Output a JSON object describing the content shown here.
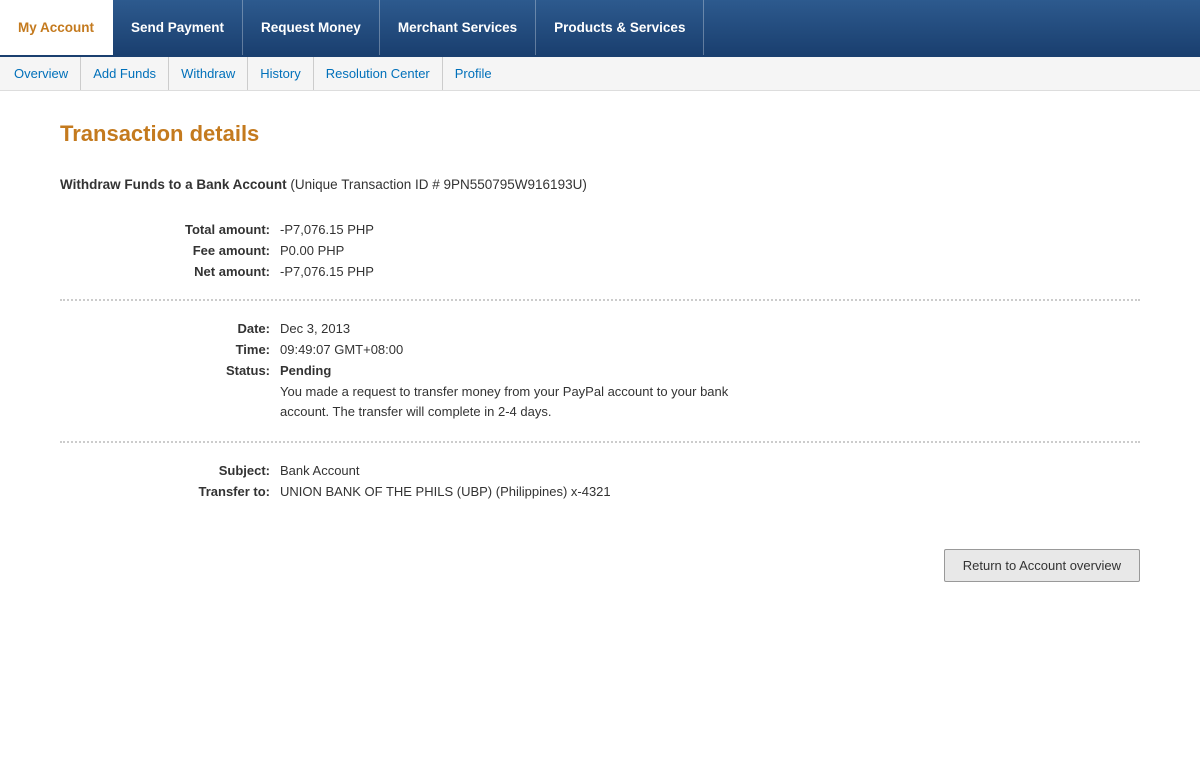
{
  "top_nav": {
    "items": [
      {
        "id": "my-account",
        "label": "My Account",
        "active": true
      },
      {
        "id": "send-payment",
        "label": "Send Payment",
        "active": false
      },
      {
        "id": "request-money",
        "label": "Request Money",
        "active": false
      },
      {
        "id": "merchant-services",
        "label": "Merchant Services",
        "active": false
      },
      {
        "id": "products-services",
        "label": "Products & Services",
        "active": false
      }
    ]
  },
  "sub_nav": {
    "items": [
      {
        "id": "overview",
        "label": "Overview"
      },
      {
        "id": "add-funds",
        "label": "Add Funds"
      },
      {
        "id": "withdraw",
        "label": "Withdraw"
      },
      {
        "id": "history",
        "label": "History"
      },
      {
        "id": "resolution-center",
        "label": "Resolution Center"
      },
      {
        "id": "profile",
        "label": "Profile"
      }
    ]
  },
  "page": {
    "title": "Transaction details",
    "transaction_header_bold": "Withdraw Funds to a Bank Account",
    "transaction_id_text": "(Unique Transaction ID # 9PN550795W916193U)",
    "total_amount_label": "Total amount:",
    "total_amount_value": "-P7,076.15 PHP",
    "fee_amount_label": "Fee amount:",
    "fee_amount_value": "P0.00 PHP",
    "net_amount_label": "Net amount:",
    "net_amount_value": "-P7,076.15 PHP",
    "date_label": "Date:",
    "date_value": "Dec 3, 2013",
    "time_label": "Time:",
    "time_value": "09:49:07 GMT+08:00",
    "status_label": "Status:",
    "status_value": "Pending",
    "status_description": "You made a request to transfer money from your PayPal account to your bank account. The transfer will complete in 2-4 days.",
    "subject_label": "Subject:",
    "subject_value": "Bank Account",
    "transfer_to_label": "Transfer to:",
    "transfer_to_value": "UNION BANK OF THE PHILS (UBP) (Philippines) x-4321",
    "return_button_label": "Return to Account overview"
  }
}
